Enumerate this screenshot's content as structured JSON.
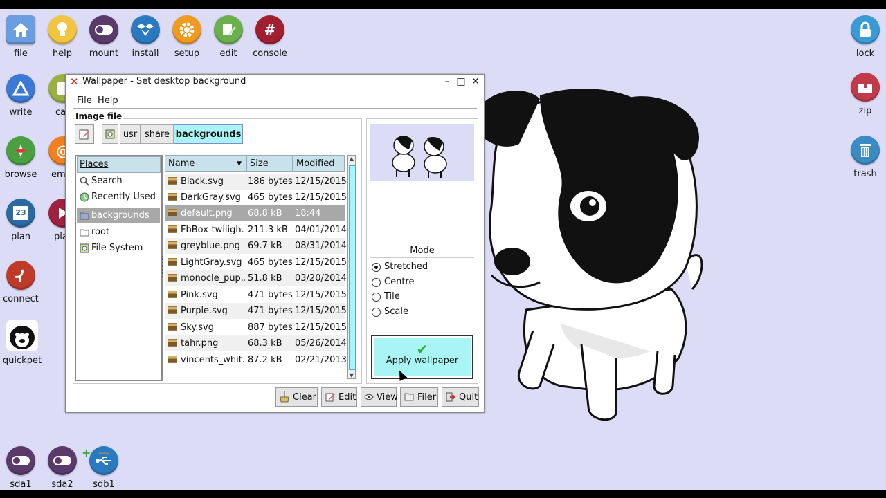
{
  "desktop": {
    "left_icons": [
      {
        "label": "file",
        "color": "#5a8fd4",
        "icon": "home-icon"
      },
      {
        "label": "help",
        "color": "#f0c040",
        "icon": "bulb-icon"
      },
      {
        "label": "mount",
        "color": "#5a3a6a",
        "icon": "toggle-icon"
      },
      {
        "label": "install",
        "color": "#2a7ac0",
        "icon": "box-icon"
      },
      {
        "label": "setup",
        "color": "#f09a20",
        "icon": "gear-icon"
      },
      {
        "label": "edit",
        "color": "#6ab04c",
        "icon": "pencil-icon"
      },
      {
        "label": "console",
        "color": "#a02030",
        "icon": "hash-icon"
      },
      {
        "label": "write",
        "color": "#3a7ad4",
        "icon": "write-icon"
      },
      {
        "label": "ca",
        "color": "#9ab040",
        "icon": "calc-icon"
      },
      {
        "label": "browse",
        "color": "#4aa040",
        "icon": "compass-icon"
      },
      {
        "label": "em",
        "color": "#f08020",
        "icon": "at-icon"
      },
      {
        "label": "plan",
        "color": "#2a6aa0",
        "icon": "calendar-icon"
      },
      {
        "label": "pla",
        "color": "#a02040",
        "icon": "play-icon"
      },
      {
        "label": "connect",
        "color": "#c03a2a",
        "icon": "satellite-icon"
      },
      {
        "label": "quickpet",
        "color": "#111111",
        "icon": "dog-icon"
      },
      {
        "label": "sda1",
        "color": "#5a3a6a",
        "icon": "drive-icon"
      },
      {
        "label": "sda2",
        "color": "#5a3a6a",
        "icon": "drive-icon"
      },
      {
        "label": "sdb1",
        "color": "#2a7ac0",
        "icon": "usb-icon"
      }
    ],
    "right_icons": [
      {
        "label": "lock",
        "color": "#3a9ad4",
        "icon": "lock-icon"
      },
      {
        "label": "zip",
        "color": "#c03a4a",
        "icon": "zip-icon"
      },
      {
        "label": "trash",
        "color": "#3a8ac4",
        "icon": "trash-icon"
      }
    ],
    "day_number": "23",
    "console_glyph": "#"
  },
  "window": {
    "title": "Wallpaper - Set desktop background",
    "menu": [
      "File",
      "Help"
    ],
    "image_file_label": "Image file",
    "breadcrumb": [
      "usr",
      "share",
      "backgrounds"
    ],
    "places_header": "Places",
    "places": [
      "Search",
      "Recently Used",
      "backgrounds",
      "root",
      "File System"
    ],
    "columns": [
      "Name",
      "Size",
      "Modified"
    ],
    "files": [
      {
        "name": "Black.svg",
        "size": "186 bytes",
        "modified": "12/15/2015"
      },
      {
        "name": "DarkGray.svg",
        "size": "465 bytes",
        "modified": "12/15/2015"
      },
      {
        "name": "default.png",
        "size": "68.8 kB",
        "modified": "18:44"
      },
      {
        "name": "FbBox-twiligh...",
        "size": "211.3 kB",
        "modified": "04/01/2014"
      },
      {
        "name": "greyblue.png",
        "size": "69.7 kB",
        "modified": "08/31/2014"
      },
      {
        "name": "LightGray.svg",
        "size": "465 bytes",
        "modified": "12/15/2015"
      },
      {
        "name": "monocle_pup...",
        "size": "51.8 kB",
        "modified": "03/20/2014"
      },
      {
        "name": "Pink.svg",
        "size": "471 bytes",
        "modified": "12/15/2015"
      },
      {
        "name": "Purple.svg",
        "size": "471 bytes",
        "modified": "12/15/2015"
      },
      {
        "name": "Sky.svg",
        "size": "887 bytes",
        "modified": "12/15/2015"
      },
      {
        "name": "tahr.png",
        "size": "68.3 kB",
        "modified": "05/26/2014"
      },
      {
        "name": "vincents_whit...",
        "size": "87.2 kB",
        "modified": "02/21/2013"
      }
    ],
    "mode_title": "Mode",
    "modes": [
      "Stretched",
      "Centre",
      "Tile",
      "Scale"
    ],
    "selected_mode": "Stretched",
    "apply_label": "Apply wallpaper",
    "buttons": [
      "Clear",
      "Edit",
      "View",
      "Filer",
      "Quit"
    ]
  },
  "colors": {
    "accent": "#a9f5f5",
    "selection": "#a8a8a8",
    "header": "#c9e1ea"
  }
}
